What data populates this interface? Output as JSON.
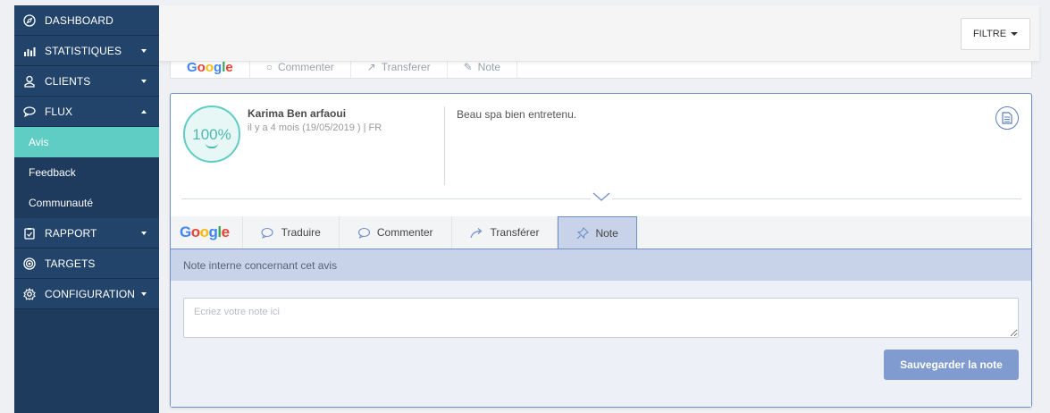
{
  "sidebar": {
    "items": [
      {
        "label": "DASHBOARD",
        "icon": "compass-icon",
        "caret": "none"
      },
      {
        "label": "STATISTIQUES",
        "icon": "bar-chart-icon",
        "caret": "down"
      },
      {
        "label": "CLIENTS",
        "icon": "user-badge-icon",
        "caret": "down"
      },
      {
        "label": "FLUX",
        "icon": "chat-bubbles-icon",
        "caret": "up"
      },
      {
        "label": "RAPPORT",
        "icon": "clipboard-icon",
        "caret": "down"
      },
      {
        "label": "TARGETS",
        "icon": "target-icon",
        "caret": "none"
      },
      {
        "label": "CONFIGURATION",
        "icon": "gear-icon",
        "caret": "down"
      }
    ],
    "flux_subitems": [
      {
        "label": "Avis",
        "active": true
      },
      {
        "label": "Feedback",
        "active": false
      },
      {
        "label": "Communauté",
        "active": false
      }
    ]
  },
  "topbar": {
    "filter_label": "FILTRE"
  },
  "prev_card": {
    "tabs": [
      "Google",
      "Commenter",
      "Transferer",
      "Note"
    ]
  },
  "review": {
    "score": "100%",
    "author": "Karima Ben arfaoui",
    "meta": "il y a 4 mois (19/05/2019 ) | FR",
    "text": "Beau spa bien entretenu."
  },
  "tabs": {
    "google": "Google",
    "translate": "Traduire",
    "comment": "Commenter",
    "transfer": "Transférer",
    "note": "Note",
    "active": "note"
  },
  "note": {
    "header": "Note interne concernant cet avis",
    "placeholder": "Ecriez votre note ici",
    "value": "",
    "save_label": "Sauvegarder la note"
  },
  "colors": {
    "sidebar_bg": "#1e3a5c",
    "sidebar_active": "#5fcdc3",
    "accent_blue": "#7f9bcf",
    "score_teal": "#5fcdc3"
  }
}
